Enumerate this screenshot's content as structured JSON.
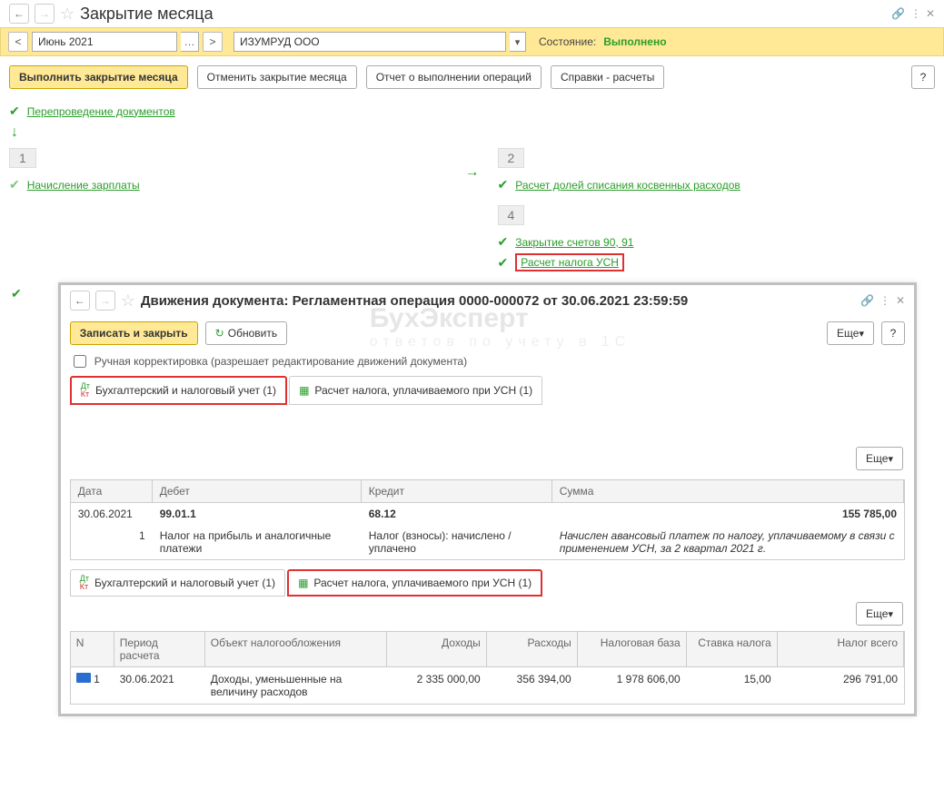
{
  "main": {
    "title": "Закрытие месяца",
    "period": "Июнь 2021",
    "org": "ИЗУМРУД ООО",
    "state_label": "Состояние:",
    "state_value": "Выполнено",
    "buttons": {
      "execute": "Выполнить закрытие месяца",
      "cancel": "Отменить закрытие месяца",
      "report": "Отчет о выполнении операций",
      "refs": "Справки - расчеты",
      "help": "?"
    },
    "link_repost": "Перепроведение документов",
    "stage1": {
      "num": "1",
      "item": "Начисление зарплаты"
    },
    "stage2": {
      "num": "2",
      "item": "Расчет долей списания косвенных расходов"
    },
    "stage4": {
      "num": "4",
      "item1": "Закрытие счетов 90, 91",
      "item2": "Расчет налога УСН"
    }
  },
  "modal": {
    "title": "Движения документа: Регламентная операция 0000-000072 от 30.06.2021 23:59:59",
    "save_close": "Записать и закрыть",
    "refresh": "Обновить",
    "more": "Еще",
    "help": "?",
    "manual_edit": "Ручная корректировка (разрешает редактирование движений документа)",
    "tab1": "Бухгалтерский и налоговый учет (1)",
    "tab2": "Расчет налога, уплачиваемого при УСН (1)",
    "tbl1": {
      "h_date": "Дата",
      "h_debit": "Дебет",
      "h_credit": "Кредит",
      "h_sum": "Сумма",
      "date": "30.06.2021",
      "n": "1",
      "deb": "99.01.1",
      "deb_sub": "Налог на прибыль и аналогичные платежи",
      "cred": "68.12",
      "cred_sub": "Налог (взносы): начислено / уплачено",
      "sum": "155 785,00",
      "comment": "Начислен авансовый платеж по налогу, уплачиваемому в связи с применением УСН, за 2 квартал 2021 г."
    },
    "tbl2": {
      "h_n": "N",
      "h_period": "Период расчета",
      "h_obj": "Объект налогообложения",
      "h_inc": "Доходы",
      "h_exp": "Расходы",
      "h_base": "Налоговая база",
      "h_rate": "Ставка налога",
      "h_tax": "Налог всего",
      "n": "1",
      "period": "30.06.2021",
      "obj": "Доходы, уменьшенные на величину расходов",
      "inc": "2 335 000,00",
      "exp": "356 394,00",
      "base": "1 978 606,00",
      "rate": "15,00",
      "tax": "296 791,00"
    }
  },
  "watermark": {
    "l1": "БухЭксперт",
    "l2": "ответов по учету в 1С"
  }
}
